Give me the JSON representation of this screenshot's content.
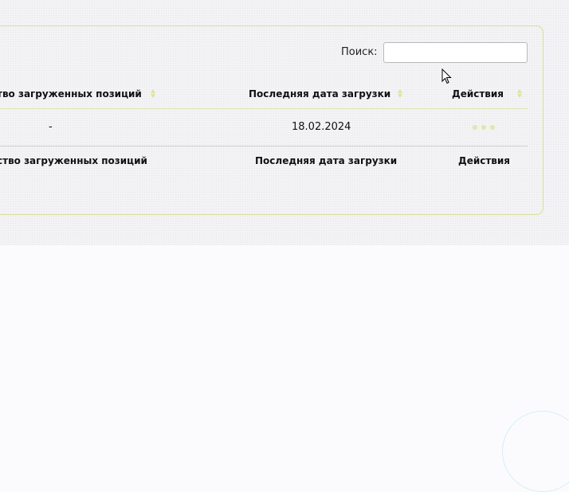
{
  "search": {
    "label": "Поиск:",
    "value": ""
  },
  "table": {
    "headers": [
      "тво загруженных позиций",
      "Последняя дата загрузки",
      "Действия"
    ],
    "rows": [
      {
        "count": "-",
        "last_date": "18.02.2024"
      }
    ],
    "footers": [
      "ство загруженных позиций",
      "Последняя дата загрузки",
      "Действия"
    ]
  },
  "colors": {
    "accent": "#dcdf9a"
  }
}
